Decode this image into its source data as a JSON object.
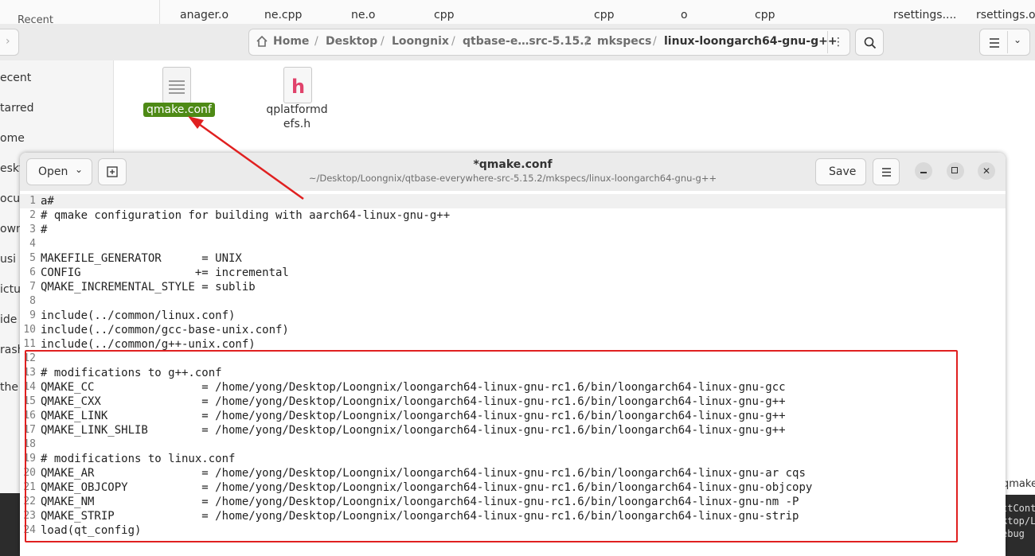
{
  "background_strip": {
    "items": [
      "anager.o",
      "ne.cpp",
      "ne.o",
      "cpp",
      "cpp",
      "o",
      "cpp",
      "rsettings....",
      "rsettings.o"
    ],
    "left_fragment": "Recent"
  },
  "file_manager": {
    "breadcrumbs": [
      "Home",
      "Desktop",
      "Loongnix",
      "qtbase-e…src-5.15.2",
      "mkspecs",
      "linux-loongarch64-gnu-g++"
    ],
    "sidebar": [
      "ecent",
      "tarred",
      "ome",
      "eskt",
      "ocu",
      "own",
      "usi",
      "ictu",
      "ide",
      "rash",
      "the"
    ],
    "files": [
      {
        "name": "qmake.conf",
        "icon": "text-file-icon",
        "selected": true
      },
      {
        "name": "qplatformdefs.h",
        "name_line1": "qplatformd",
        "name_line2": "efs.h",
        "icon": "header-file-icon",
        "selected": false
      }
    ]
  },
  "gedit": {
    "open_label": "Open",
    "title": "*qmake.conf",
    "subtitle": "~/Desktop/Loongnix/qtbase-everywhere-src-5.15.2/mkspecs/linux-loongarch64-gnu-g++",
    "save_label": "Save",
    "lines": [
      "a#",
      "# qmake configuration for building with aarch64-linux-gnu-g++",
      "#",
      "",
      "MAKEFILE_GENERATOR      = UNIX",
      "CONFIG                 += incremental",
      "QMAKE_INCREMENTAL_STYLE = sublib",
      "",
      "include(../common/linux.conf)",
      "include(../common/gcc-base-unix.conf)",
      "include(../common/g++-unix.conf)",
      "",
      "# modifications to g++.conf",
      "QMAKE_CC                = /home/yong/Desktop/Loongnix/loongarch64-linux-gnu-rc1.6/bin/loongarch64-linux-gnu-gcc",
      "QMAKE_CXX               = /home/yong/Desktop/Loongnix/loongarch64-linux-gnu-rc1.6/bin/loongarch64-linux-gnu-g++",
      "QMAKE_LINK              = /home/yong/Desktop/Loongnix/loongarch64-linux-gnu-rc1.6/bin/loongarch64-linux-gnu-g++",
      "QMAKE_LINK_SHLIB        = /home/yong/Desktop/Loongnix/loongarch64-linux-gnu-rc1.6/bin/loongarch64-linux-gnu-g++",
      "",
      "# modifications to linux.conf",
      "QMAKE_AR                = /home/yong/Desktop/Loongnix/loongarch64-linux-gnu-rc1.6/bin/loongarch64-linux-gnu-ar cqs",
      "QMAKE_OBJCOPY           = /home/yong/Desktop/Loongnix/loongarch64-linux-gnu-rc1.6/bin/loongarch64-linux-gnu-objcopy",
      "QMAKE_NM                = /home/yong/Desktop/Loongnix/loongarch64-linux-gnu-rc1.6/bin/loongarch64-linux-gnu-nm -P",
      "QMAKE_STRIP             = /home/yong/Desktop/Loongnix/loongarch64-linux-gnu-rc1.6/bin/loongarch64-linux-gnu-strip",
      "load(qt_config)"
    ],
    "line_numbers": [
      "1",
      "2",
      "3",
      "4",
      "5",
      "6",
      "7",
      "8",
      "9",
      "10",
      "11",
      "12",
      "13",
      "14",
      "15",
      "16",
      "17",
      "18",
      "19",
      "20",
      "21",
      "22",
      "23",
      "24"
    ]
  },
  "right_terminal_fragments": [
    "ttCont",
    "ktop/Lo",
    "ebug"
  ],
  "right_filename_fragment": "qmake.",
  "colors": {
    "selection": "#4e8a16",
    "annotation": "#e02020",
    "header_glyph": "#e0436b"
  }
}
